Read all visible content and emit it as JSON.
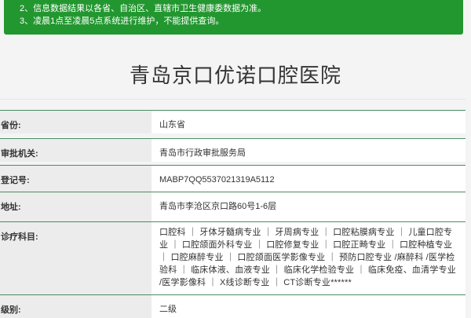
{
  "notice": {
    "lines": [
      "2、信息数据结果以各省、自治区、直辖市卫生健康委数据为准。",
      "3、凌晨1点至凌晨5点系统进行维护，不能提供查询。"
    ]
  },
  "title": "青岛京口优诺口腔医院",
  "rows": [
    {
      "label": "省份:",
      "value": "山东省"
    },
    {
      "label": "审批机关:",
      "value": "青岛市行政审批服务局"
    },
    {
      "label": "登记号:",
      "value": "MABP7QQ5537021319A5112"
    },
    {
      "label": "地址:",
      "value": "青岛市李沧区京口路60号1-6层"
    },
    {
      "label": "诊疗科目:",
      "value": "口腔科 ｜ 牙体牙髓病专业 ｜ 牙周病专业 ｜ 口腔粘膜病专业 ｜ 儿童口腔专业 ｜ 口腔颌面外科专业 ｜ 口腔修复专业 ｜ 口腔正畸专业 ｜ 口腔种植专业 ｜ 口腔麻醉专业 ｜ 口腔颌面医学影像专业 ｜ 预防口腔专业 /麻醉科 /医学检验科 ｜ 临床体液、血液专业 ｜ 临床化学检验专业 ｜ 临床免疫、血清学专业 /医学影像科 ｜ X线诊断专业 ｜ CT诊断专业******"
    },
    {
      "label": "级别:",
      "value": "二级"
    }
  ]
}
